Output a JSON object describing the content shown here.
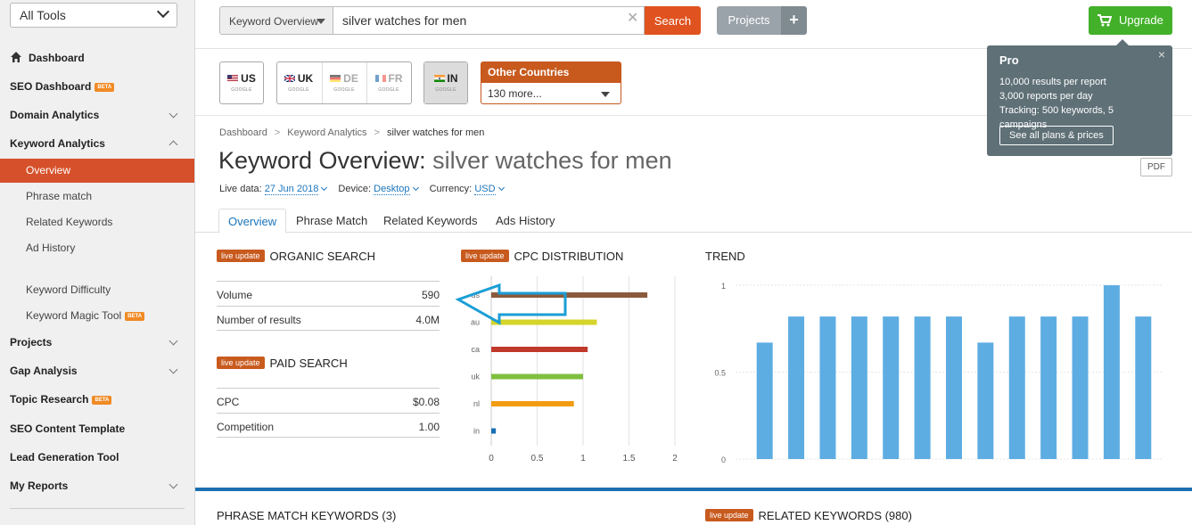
{
  "sidebar": {
    "tools_select": "All Tools",
    "items": {
      "dashboard": "Dashboard",
      "seo_dashboard": "SEO Dashboard",
      "domain_analytics": "Domain Analytics",
      "keyword_analytics": "Keyword Analytics",
      "overview": "Overview",
      "phrase_match": "Phrase match",
      "related_keywords": "Related Keywords",
      "ad_history": "Ad History",
      "keyword_difficulty": "Keyword Difficulty",
      "keyword_magic_tool": "Keyword Magic Tool",
      "projects": "Projects",
      "gap_analysis": "Gap Analysis",
      "topic_research": "Topic Research",
      "seo_content_template": "SEO Content Template",
      "lead_generation_tool": "Lead Generation Tool",
      "my_reports": "My Reports"
    },
    "beta_label": "BETA"
  },
  "topbar": {
    "report_select": "Keyword Overview",
    "search_value": "silver watches for men",
    "search_button": "Search",
    "projects_button": "Projects",
    "projects_plus": "+",
    "upgrade_button": "Upgrade"
  },
  "countries": {
    "us": "US",
    "uk": "UK",
    "de": "DE",
    "fr": "FR",
    "in": "IN",
    "engine": "GOOGLE",
    "other_header": "Other Countries",
    "other_value": "130 more..."
  },
  "breadcrumb": {
    "dashboard": "Dashboard",
    "keyword_analytics": "Keyword Analytics",
    "current": "silver watches for men",
    "sep": ">"
  },
  "page": {
    "title_prefix": "Keyword Overview:",
    "title_keyword": "silver watches for men",
    "live_data_label": "Live data:",
    "live_data_value": "27 Jun 2018",
    "device_label": "Device:",
    "device_value": "Desktop",
    "currency_label": "Currency:",
    "currency_value": "USD",
    "pdf": "PDF"
  },
  "tabs": [
    "Overview",
    "Phrase Match",
    "Related Keywords",
    "Ads History"
  ],
  "live_badge": "live update",
  "organic": {
    "title": "ORGANIC SEARCH",
    "rows": [
      {
        "k": "Volume",
        "v": "590"
      },
      {
        "k": "Number of results",
        "v": "4.0M"
      }
    ]
  },
  "paid": {
    "title": "PAID SEARCH",
    "rows": [
      {
        "k": "CPC",
        "v": "$0.08"
      },
      {
        "k": "Competition",
        "v": "1.00"
      }
    ]
  },
  "cpc_title": "CPC DISTRIBUTION",
  "trend_title": "TREND",
  "bottom": {
    "phrase_match": "PHRASE MATCH KEYWORDS (3)",
    "related": "RELATED KEYWORDS (980)"
  },
  "pro_tooltip": {
    "title": "Pro",
    "lines": [
      "10,000 results per report",
      "3,000 reports per day",
      "Tracking: 500 keywords, 5 campaigns"
    ],
    "button": "See all plans & prices",
    "close": "×"
  },
  "colors": {
    "accent": "#e0521f",
    "sidebar_active": "#d6512b",
    "link": "#1b75bb",
    "upgrade": "#43b02a",
    "trend_bar": "#5dade2",
    "arrow": "#1a9ed6"
  },
  "chart_data": [
    {
      "type": "bar",
      "orientation": "horizontal",
      "title": "CPC DISTRIBUTION",
      "categories": [
        "us",
        "au",
        "ca",
        "uk",
        "nl",
        "in"
      ],
      "values": [
        1.7,
        1.15,
        1.05,
        1.0,
        0.9,
        0.05
      ],
      "colors": [
        "#8b5a3c",
        "#d4d42a",
        "#c0392b",
        "#7fbf3f",
        "#f39c12",
        "#1a6fb3"
      ],
      "xlim": [
        0,
        2
      ],
      "xticks": [
        "0",
        "0.5",
        "1",
        "1.5",
        "2"
      ]
    },
    {
      "type": "bar",
      "title": "TREND",
      "values": [
        0.67,
        0.82,
        0.82,
        0.82,
        0.82,
        0.82,
        0.82,
        0.67,
        0.82,
        0.82,
        0.82,
        1.0,
        0.82
      ],
      "ylim": [
        0,
        1
      ],
      "yticks": [
        "0",
        "0.5",
        "1"
      ],
      "color": "#5dade2"
    }
  ]
}
